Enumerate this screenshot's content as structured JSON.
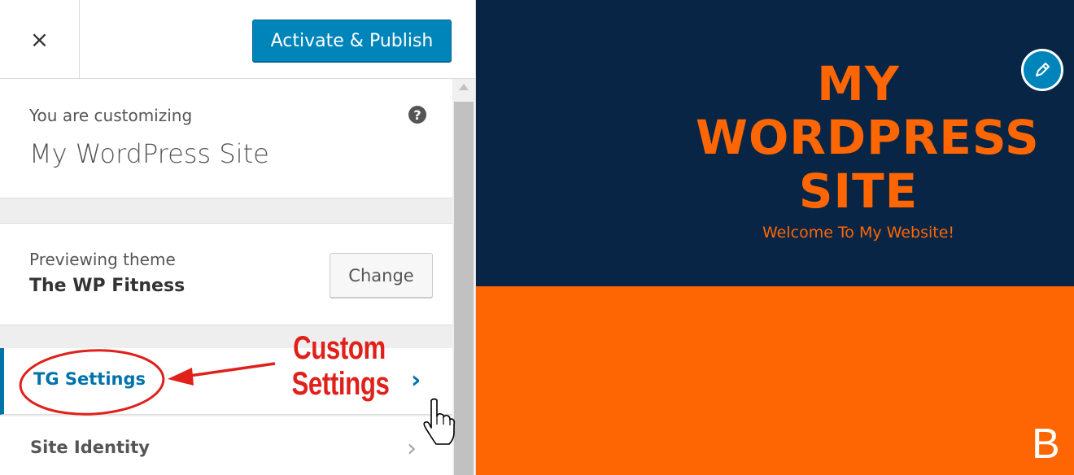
{
  "header": {
    "close_icon": "×",
    "publish_label": "Activate & Publish"
  },
  "info": {
    "customizing_label": "You are customizing",
    "site_name": "My WordPress Site",
    "help_glyph": "?"
  },
  "theme": {
    "previewing_label": "Previewing theme",
    "name": "The WP Fitness",
    "change_label": "Change"
  },
  "menu": {
    "items": [
      {
        "label": "TG Settings",
        "chevron": "›"
      },
      {
        "label": "Site Identity",
        "chevron": "›"
      }
    ]
  },
  "annotation": {
    "line1": "Custom",
    "line2": "Settings",
    "color": "#e0201a"
  },
  "preview": {
    "title_lines": [
      "MY",
      "WORDPRESS",
      "SITE"
    ],
    "tagline": "Welcome To My Website!",
    "corner_letter": "B",
    "colors": {
      "hero_bg": "#092546",
      "accent": "#fd6602",
      "primary_button": "#0085ba"
    }
  }
}
